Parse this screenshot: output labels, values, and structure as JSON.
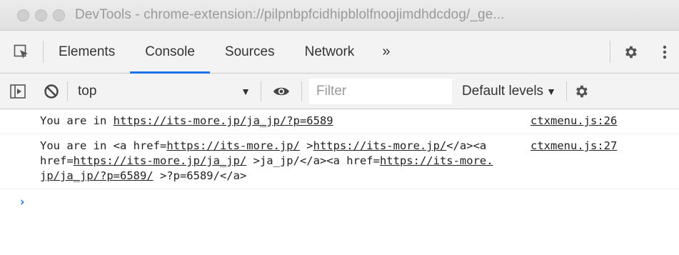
{
  "window": {
    "title": "DevTools - chrome-extension://pilpnbpfcidhipblolfnoojimdhdcdog/_ge..."
  },
  "tabs": [
    {
      "label": "Elements"
    },
    {
      "label": "Console"
    },
    {
      "label": "Sources"
    },
    {
      "label": "Network"
    }
  ],
  "tabs_more": "»",
  "toolbar": {
    "context": "top",
    "filter_placeholder": "Filter",
    "levels_label": "Default levels"
  },
  "messages": [
    {
      "prefix": "You are in ",
      "link": "https://its-more.jp/ja_jp/?p=6589",
      "source": "ctxmenu.js:26"
    },
    {
      "p1": "You are in <a href=",
      "l1": "https://its-more.jp/",
      "p2": " >",
      "l2": "https://its-more.jp/",
      "p3": "</a><a href=",
      "l3": "https://its-more.jp/ja_jp/",
      "p4": " >ja_jp/</a><a href=",
      "l4": "https://its-more.jp/ja_jp/?p=6589/",
      "p5": " >?p=6589/</a>",
      "source": "ctxmenu.js:27"
    }
  ],
  "prompt_symbol": "›",
  "colors": {
    "accent": "#1a73e8",
    "titlebar": "#e4e4e4",
    "toolbar": "#f3f3f3"
  },
  "icons": [
    "inspect-element-icon",
    "settings-gear-icon",
    "more-vertical-icon",
    "sidebar-toggle-icon",
    "clear-console-icon",
    "eye-icon",
    "chevron-down-icon"
  ]
}
